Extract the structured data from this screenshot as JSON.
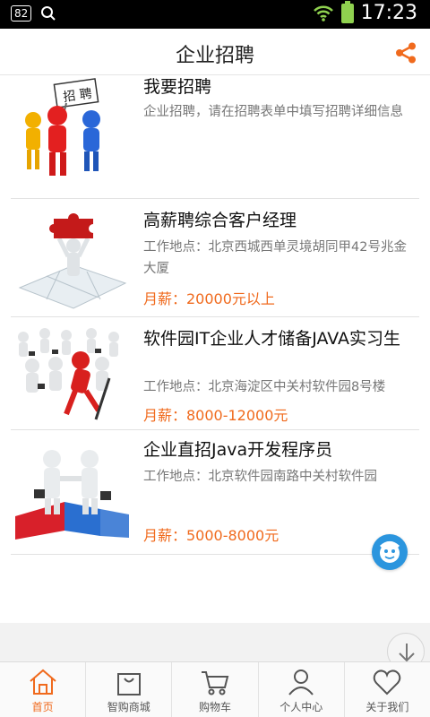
{
  "status_bar": {
    "battery_level": "82",
    "time": "17:23"
  },
  "header": {
    "title": "企业招聘"
  },
  "items": [
    {
      "title": "我要招聘",
      "desc": "企业招聘，请在招聘表单中填写招聘详细信息",
      "salary": ""
    },
    {
      "title": "高薪聘综合客户经理",
      "desc": "工作地点：北京西城西单灵境胡同甲42号兆金大厦",
      "salary": "月薪：20000元以上"
    },
    {
      "title": "软件园IT企业人才储备JAVA实习生",
      "desc": "工作地点：北京海淀区中关村软件园8号楼",
      "salary": "月薪：8000-12000元"
    },
    {
      "title": "企业直招Java开发程序员",
      "desc": "工作地点：北京软件园南路中关村软件园",
      "salary": "月薪：5000-8000元"
    }
  ],
  "nav": [
    {
      "label": "首页",
      "icon": "home-icon"
    },
    {
      "label": "智购商城",
      "icon": "bag-icon"
    },
    {
      "label": "购物车",
      "icon": "cart-icon"
    },
    {
      "label": "个人中心",
      "icon": "person-icon"
    },
    {
      "label": "关于我们",
      "icon": "heart-icon"
    }
  ],
  "colors": {
    "accent": "#f06a1d",
    "float_button": "#2b95de"
  }
}
